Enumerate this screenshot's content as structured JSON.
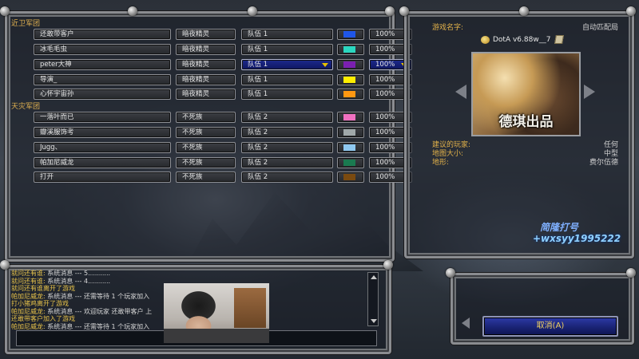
{
  "teams": [
    {
      "label": "近卫军团",
      "players": [
        {
          "name": "还敢带客户",
          "race": "暗夜精灵",
          "team": "队伍 1",
          "color": "#1f56e8",
          "handicap": "100%",
          "active": false
        },
        {
          "name": "冰毛毛虫",
          "race": "暗夜精灵",
          "team": "队伍 1",
          "color": "#2ad7c0",
          "handicap": "100%",
          "active": false
        },
        {
          "name": "peter大神",
          "race": "暗夜精灵",
          "team": "队伍 1",
          "color": "#7b1fb0",
          "handicap": "100%",
          "active": true
        },
        {
          "name": "导演_",
          "race": "暗夜精灵",
          "team": "队伍 1",
          "color": "#ffee00",
          "handicap": "100%",
          "active": false
        },
        {
          "name": "心怀宇宙孙",
          "race": "暗夜精灵",
          "team": "队伍 1",
          "color": "#ff9812",
          "handicap": "100%",
          "active": false
        }
      ]
    },
    {
      "label": "天灾军团",
      "players": [
        {
          "name": "一落叶而已",
          "race": "不死族",
          "team": "队伍 2",
          "color": "#f070c0",
          "handicap": "100%",
          "active": false
        },
        {
          "name": "瓣溪服饰考",
          "race": "不死族",
          "team": "队伍 2",
          "color": "#a0a8aa",
          "handicap": "100%",
          "active": false
        },
        {
          "name": "Jugg、",
          "race": "不死族",
          "team": "队伍 2",
          "color": "#8ec8f0",
          "handicap": "100%",
          "active": false
        },
        {
          "name": "帕加尼威龙",
          "race": "不死族",
          "team": "队伍 2",
          "color": "#1a7a50",
          "handicap": "100%",
          "active": false
        },
        {
          "name": "打开",
          "race": "不死族",
          "team": "队伍 2",
          "color": "#7a4a10",
          "handicap": "100%",
          "active": false
        }
      ]
    }
  ],
  "game_info": {
    "name_label": "游戏名字:",
    "name_value": "自动匹配局",
    "map_name": "DotA v6.88w__7",
    "preview_caption": "德琪出品",
    "suggested_players_label": "建议的玩家:",
    "suggested_players_value": "任何",
    "map_size_label": "地图大小:",
    "map_size_value": "中型",
    "terrain_label": "地形:",
    "terrain_value": "费尔伍德"
  },
  "watermark": {
    "line1": "简隆打号",
    "line2": "+wxsyy1995222"
  },
  "chat": {
    "lines": [
      {
        "name": "就问还有谁:",
        "msg": " 系统消息 --- 5..........."
      },
      {
        "name": "就问还有谁:",
        "msg": " 系统消息 --- 4..........."
      },
      {
        "name": "",
        "msg": "就问还有谁离开了游戏"
      },
      {
        "name": "帕加尼威龙:",
        "msg": " 系统消息 --- 还需等待 1 个玩家加入"
      },
      {
        "name": "",
        "msg": "打小猪鸡离开了游戏"
      },
      {
        "name": "帕加尼威龙:",
        "msg": " 系统消息 --- 欢迎玩家 还敢带客户 上"
      },
      {
        "name": "",
        "msg": "还敢带客户加入了游戏"
      },
      {
        "name": "帕加尼威龙:",
        "msg": " 系统消息 --- 还需等待 1 个玩家加入"
      }
    ],
    "input_value": ""
  },
  "buttons": {
    "cancel_label": "取消(A)"
  },
  "colors": {
    "accent_gold": "#e3b24a",
    "button_blue": "#1d2a8c"
  }
}
